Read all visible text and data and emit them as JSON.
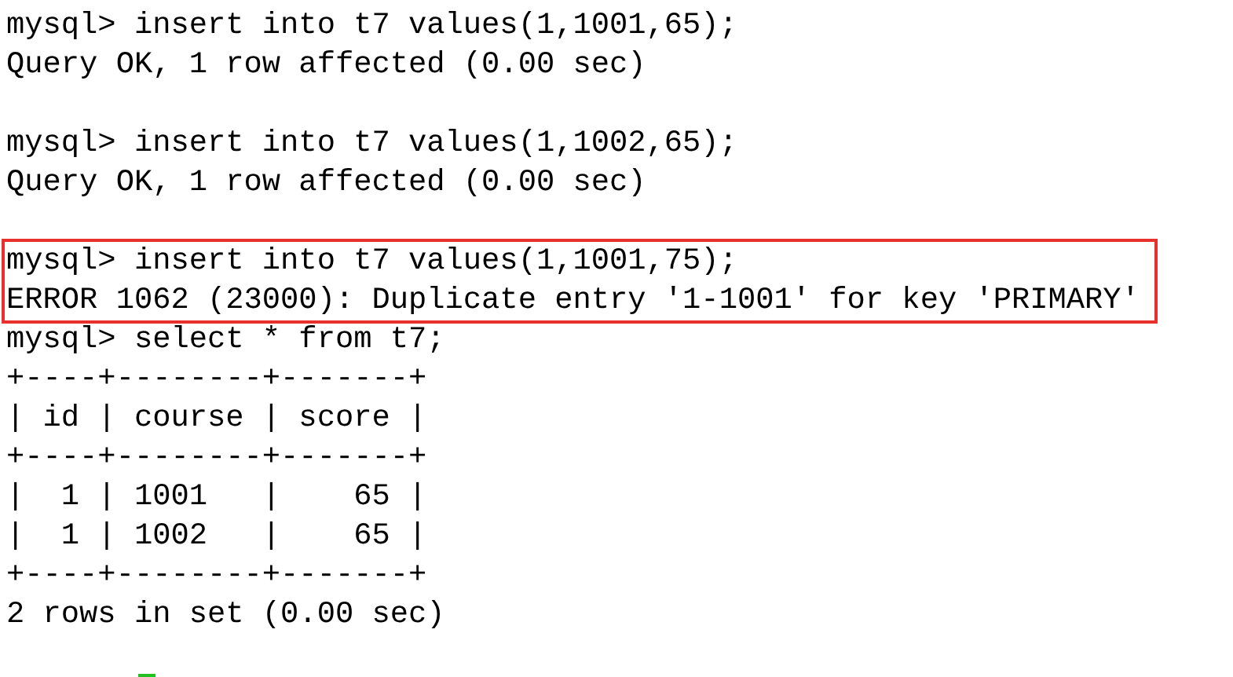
{
  "terminal": {
    "blocks": [
      {
        "highlighted": false,
        "lines": [
          {
            "kind": "text",
            "text": "mysql> insert into t7 values(1,1001,65);"
          },
          {
            "kind": "text",
            "text": "Query OK, 1 row affected (0.00 sec)"
          },
          {
            "kind": "blank"
          },
          {
            "kind": "text",
            "text": "mysql> insert into t7 values(1,1002,65);"
          },
          {
            "kind": "text",
            "text": "Query OK, 1 row affected (0.00 sec)"
          },
          {
            "kind": "blank"
          }
        ]
      },
      {
        "highlighted": true,
        "lines": [
          {
            "kind": "text",
            "text": "mysql> insert into t7 values(1,1001,75);"
          },
          {
            "kind": "text",
            "text": "ERROR 1062 (23000): Duplicate entry '1-1001' for key 'PRIMARY'"
          }
        ]
      },
      {
        "highlighted": false,
        "lines": [
          {
            "kind": "text",
            "text": "mysql> select * from t7;"
          },
          {
            "kind": "text",
            "text": "+----+--------+-------+"
          },
          {
            "kind": "text",
            "text": "| id | course | score |"
          },
          {
            "kind": "text",
            "text": "+----+--------+-------+"
          },
          {
            "kind": "text",
            "text": "|  1 | 1001   |    65 |"
          },
          {
            "kind": "text",
            "text": "|  1 | 1002   |    65 |"
          },
          {
            "kind": "text",
            "text": "+----+--------+-------+"
          },
          {
            "kind": "text",
            "text": "2 rows in set (0.00 sec)"
          },
          {
            "kind": "blank"
          }
        ]
      }
    ],
    "cursor": {
      "visible": true
    }
  }
}
